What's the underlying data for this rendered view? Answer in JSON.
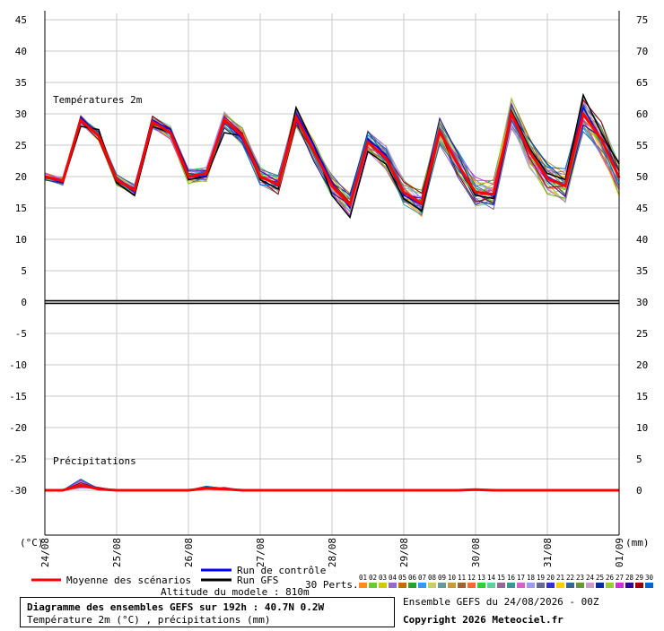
{
  "chart_data": {
    "type": "line",
    "title": "Diagramme des ensembles GEFS sur 192h : 40.7N 0.2W",
    "subtitle": "Température 2m (°C) , précipitations (mm)",
    "panel_label_temp": "Températures 2m",
    "panel_label_precip": "Précipitations",
    "ylabel_left": "(°C)",
    "ylabel_right": "(mm)",
    "y_left_ticks": [
      "45",
      "40",
      "35",
      "30",
      "25",
      "20",
      "15",
      "10",
      "5",
      "0",
      "-5",
      "-10",
      "-15",
      "-20",
      "-25",
      "-30"
    ],
    "y_right_ticks": [
      "75",
      "70",
      "65",
      "60",
      "55",
      "50",
      "45",
      "40",
      "35",
      "30",
      "25",
      "20",
      "15",
      "10",
      "5",
      "0"
    ],
    "ylim": [
      -30,
      45
    ],
    "x_tick_labels": [
      "24/08",
      "25/08",
      "26/08",
      "27/08",
      "28/08",
      "29/08",
      "30/08",
      "31/08",
      "01/09"
    ],
    "x_steps_hours": [
      0,
      6,
      12,
      18,
      24,
      30,
      36,
      42,
      48,
      54,
      60,
      66,
      72,
      78,
      84,
      90,
      96,
      102,
      108,
      114,
      120,
      126,
      132,
      138,
      144,
      150,
      156,
      162,
      168,
      174,
      180,
      186,
      192
    ],
    "series": [
      {
        "name": "Moyenne des scénarios",
        "color": "#ff0000",
        "values": [
          20,
          19.3,
          29,
          26.5,
          19.5,
          17.8,
          28.7,
          27,
          20,
          20.5,
          29,
          26.5,
          20,
          18.7,
          29.5,
          24,
          18.5,
          15.5,
          25.5,
          23,
          17.5,
          15.7,
          27.2,
          22,
          17.5,
          17.2,
          30,
          24,
          19.7,
          18.5,
          30,
          26,
          19.8
        ]
      },
      {
        "name": "Run de contrôle",
        "color": "#0000ff",
        "values": [
          20,
          19,
          29.5,
          26.5,
          19.5,
          17.5,
          29,
          27.5,
          20,
          20,
          29,
          26,
          20,
          18.5,
          30,
          25,
          19,
          15,
          26,
          23.5,
          17,
          15.5,
          27.5,
          22,
          17.5,
          17,
          30,
          24,
          20,
          18.5,
          31,
          26,
          20
        ]
      },
      {
        "name": "Run GFS",
        "color": "#000000",
        "values": [
          20,
          19,
          28,
          27.5,
          19,
          17,
          28,
          27,
          19.5,
          20,
          27,
          26.5,
          19.5,
          18,
          31,
          25,
          17,
          13.5,
          24,
          22,
          16.5,
          14.5,
          27,
          22,
          17,
          16.5,
          30.5,
          24.5,
          20.5,
          19.5,
          33,
          27,
          22
        ]
      }
    ],
    "precip_mean_mm": [
      0,
      0,
      0.8,
      0.2,
      0,
      0,
      0,
      0,
      0,
      0.3,
      0.2,
      0,
      0,
      0,
      0,
      0,
      0,
      0,
      0,
      0,
      0,
      0,
      0,
      0,
      0.1,
      0,
      0,
      0,
      0,
      0,
      0,
      0,
      0
    ],
    "legend_perts_label": "30 Perts.",
    "perturbation_ids": [
      "01",
      "02",
      "03",
      "04",
      "05",
      "06",
      "07",
      "08",
      "09",
      "10",
      "11",
      "12",
      "13",
      "14",
      "15",
      "16",
      "17",
      "18",
      "19",
      "20",
      "21",
      "22",
      "23",
      "24",
      "25",
      "26",
      "27",
      "28",
      "29",
      "30"
    ],
    "perturbation_colors": [
      "#ff8c1a",
      "#66cc33",
      "#cccc00",
      "#9966cc",
      "#cc6600",
      "#339933",
      "#3399ff",
      "#cccc66",
      "#669999",
      "#cc9933",
      "#996633",
      "#ff6633",
      "#33cc33",
      "#66cc99",
      "#996699",
      "#339999",
      "#cc66cc",
      "#9999ff",
      "#666699",
      "#3333cc",
      "#ffcc00",
      "#336699",
      "#669933",
      "#cc99cc",
      "#003399",
      "#99cc33",
      "#cc33cc",
      "#330099",
      "#990000",
      "#0066cc"
    ],
    "grid": true,
    "legend_position": "bottom"
  },
  "footer": {
    "altitude": "Altitude du modele : 810m",
    "ensemble_info": "Ensemble GEFS du 24/08/2026 - 00Z",
    "copyright": "Copyright 2026 Meteociel.fr"
  }
}
